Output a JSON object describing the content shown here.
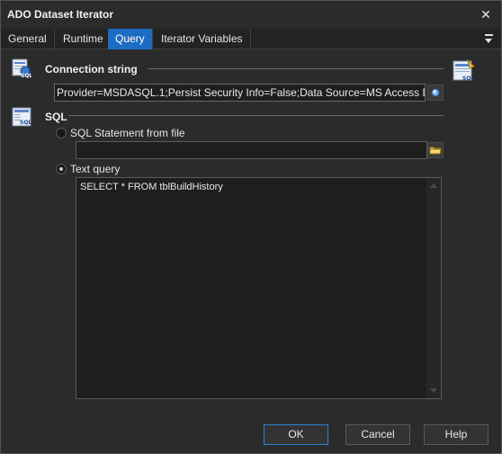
{
  "window": {
    "title": "ADO Dataset Iterator",
    "close_icon": "close-icon"
  },
  "tabs": [
    {
      "label": "General",
      "active": false
    },
    {
      "label": "Runtime",
      "active": false
    },
    {
      "label": "Query",
      "active": true
    },
    {
      "label": "Iterator Variables",
      "active": false
    }
  ],
  "connection": {
    "section_label": "Connection string",
    "value": "Provider=MSDASQL.1;Persist Security Info=False;Data Source=MS Access Database",
    "browse_icon": "ellipsis-icon",
    "builder_icon": "sql-builder-icon"
  },
  "sql": {
    "section_label": "SQL",
    "option_file_label": "SQL Statement from file",
    "option_file_selected": false,
    "file_path": "",
    "file_browse_icon": "folder-icon",
    "option_text_label": "Text query",
    "option_text_selected": true,
    "query_text": "SELECT * FROM tblBuildHistory"
  },
  "buttons": {
    "ok_label": "OK",
    "cancel_label": "Cancel",
    "help_label": "Help"
  },
  "colors": {
    "accent": "#1c6cc4",
    "background": "#2b2b2b",
    "field_background": "#1e1e1e"
  }
}
